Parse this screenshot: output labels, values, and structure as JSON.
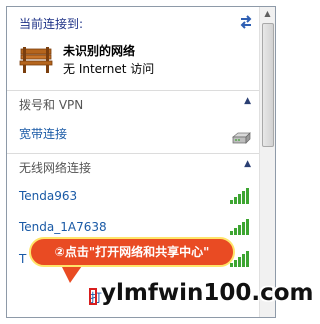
{
  "header": {
    "connected_label": "当前连接到:",
    "refresh_icon": "refresh-icon"
  },
  "current_network": {
    "icon": "bench-icon",
    "name": "未识别的网络",
    "status": "无 Internet 访问"
  },
  "sections": {
    "dialup": {
      "title": "拨号和 VPN",
      "items": [
        {
          "label": "宽带连接",
          "icon": "modem-icon"
        }
      ]
    },
    "wireless": {
      "title": "无线网络连接",
      "items": [
        {
          "label": "Tenda963",
          "icon": "signal-full-icon"
        },
        {
          "label": "Tenda_1A7638",
          "icon": "signal-full-icon"
        },
        {
          "label": "T",
          "icon": "signal-full-icon"
        }
      ]
    }
  },
  "footer": {
    "open_center_link": "打"
  },
  "annotation": {
    "callout_text": "②点击\"打开网络和共享中心\"",
    "callout_color": "#e94b23",
    "callout_border": "#ffe46a",
    "highlight_color": "#d81e1e"
  },
  "watermark": {
    "text": "ylmfwin100.com"
  },
  "colors": {
    "link": "#1a5aa6",
    "header_text": "#1e3287",
    "signal": "#3da531"
  }
}
